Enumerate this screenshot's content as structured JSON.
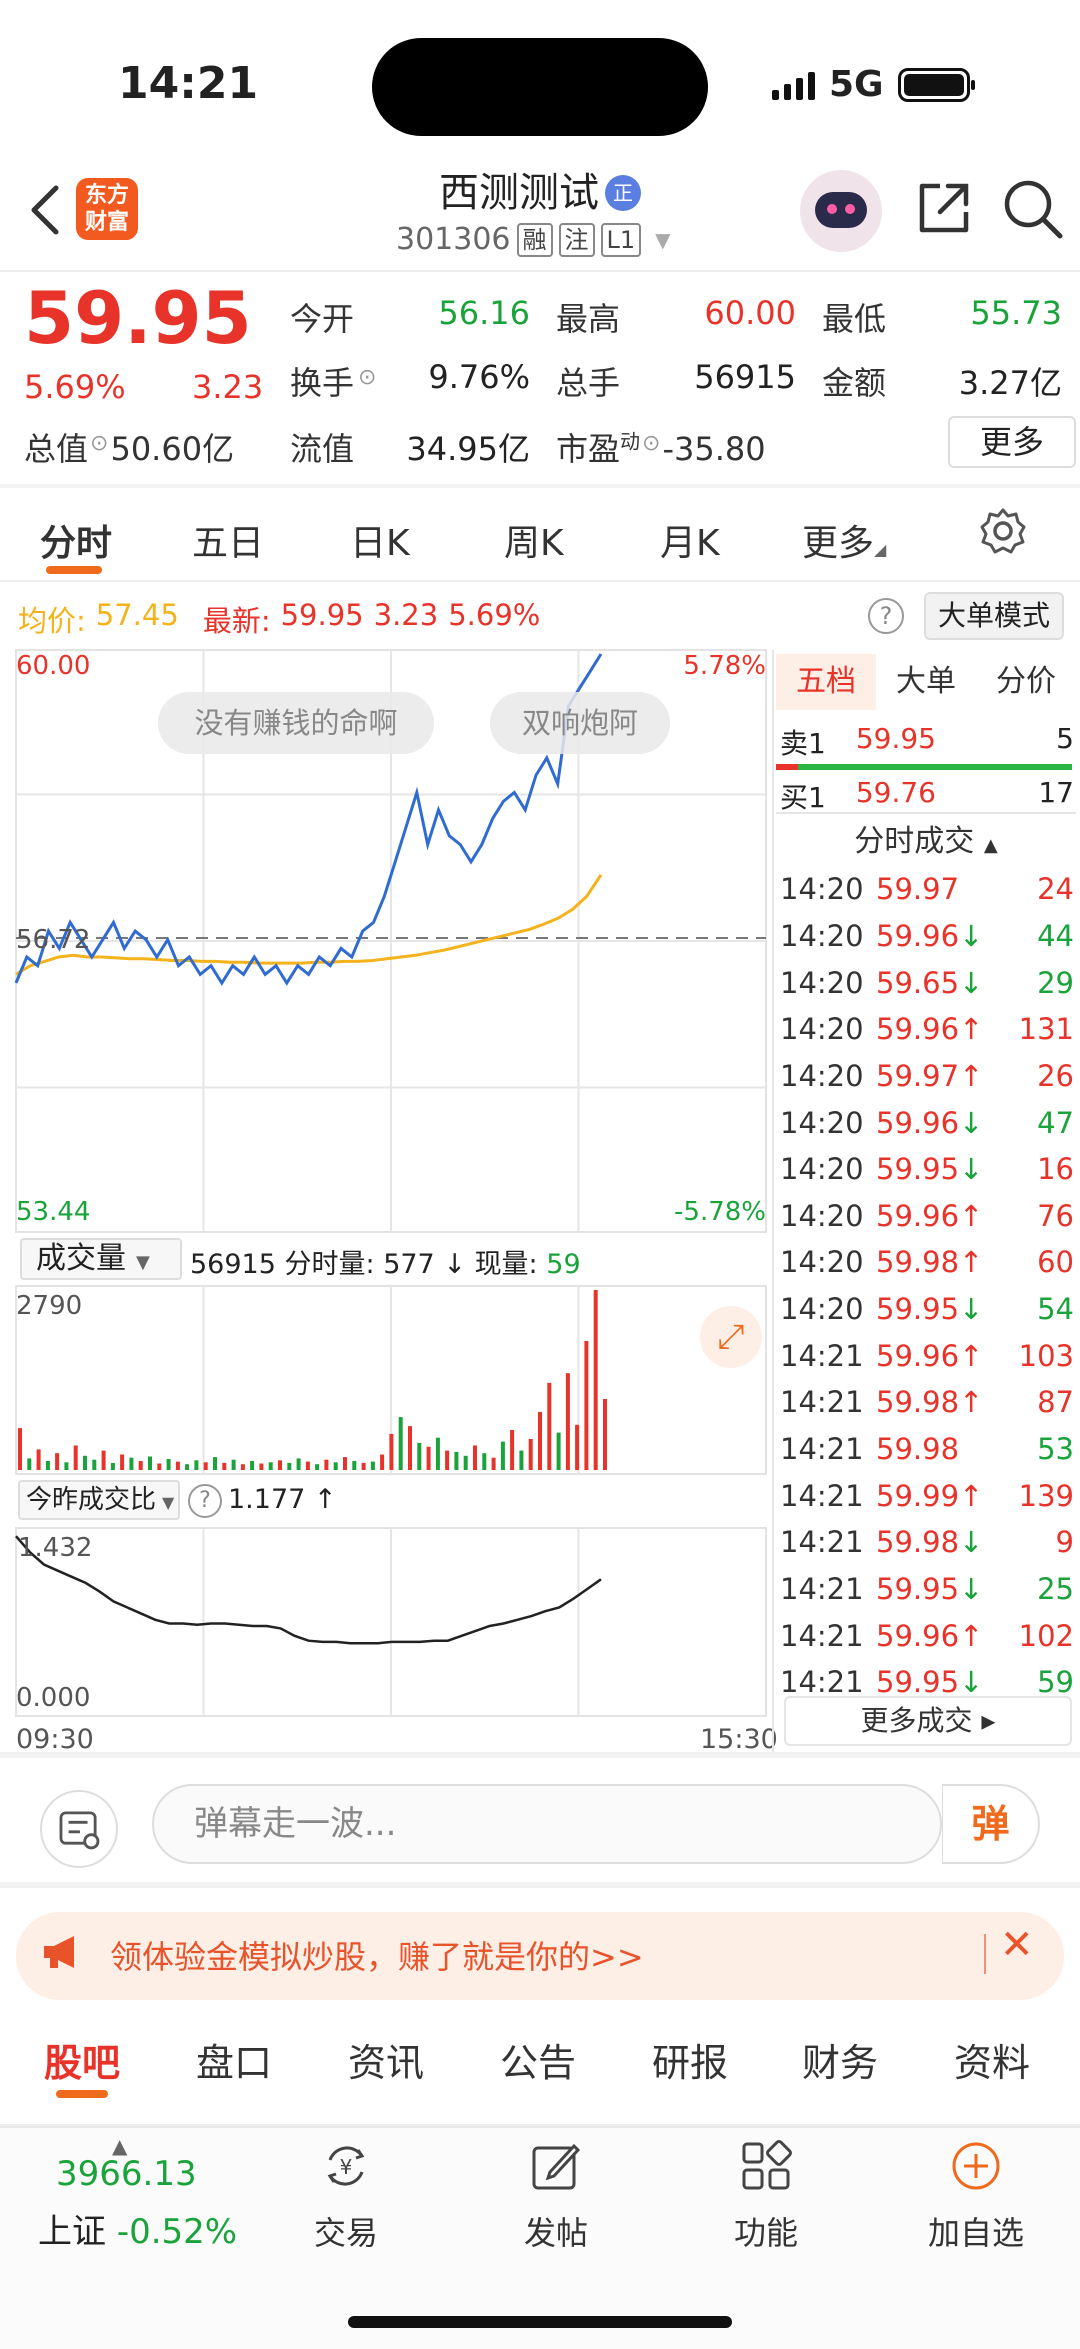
{
  "status": {
    "time": "14:21",
    "network": "5G"
  },
  "header": {
    "logo_line1": "东方",
    "logo_line2": "财富",
    "name": "西测测试",
    "cert_badge": "正",
    "code": "301306",
    "tags": [
      "融",
      "注",
      "L1"
    ]
  },
  "quote": {
    "price": "59.95",
    "change_pct": "5.69%",
    "change_abs": "3.23",
    "rows": [
      [
        {
          "label": "今开",
          "value": "56.16",
          "color": "green"
        },
        {
          "label": "最高",
          "value": "60.00",
          "color": "red"
        },
        {
          "label": "最低",
          "value": "55.73",
          "color": "green"
        }
      ],
      [
        {
          "label": "换手",
          "value": "9.76%",
          "color": "dark"
        },
        {
          "label": "总手",
          "value": "56915",
          "color": "dark"
        },
        {
          "label": "金额",
          "value": "3.27亿",
          "color": "dark"
        }
      ]
    ],
    "row3": {
      "total_label": "总值",
      "total_value": "50.60亿",
      "float_label": "流值",
      "float_value": "34.95亿",
      "pe_label": "市盈",
      "pe_sup": "动",
      "pe_value": "-35.80"
    },
    "more_label": "更多"
  },
  "period_tabs": [
    "分时",
    "五日",
    "日K",
    "周K",
    "月K",
    "更多"
  ],
  "info_line": {
    "avg_label": "均价:",
    "avg_value": "57.45",
    "latest_label": "最新:",
    "latest_value": "59.95",
    "latest_chg": "3.23",
    "latest_pct": "5.69%"
  },
  "big_order_mode": "大单模式",
  "chart_data": [
    {
      "type": "line",
      "x_range": [
        "09:30",
        "15:30"
      ],
      "y_max_label": "60.00",
      "y_min_label": "53.44",
      "ref_label": "56.72",
      "pct_max_label": "5.78%",
      "pct_min_label": "-5.78%",
      "ylim": [
        53.44,
        60.0
      ],
      "reference": 56.72,
      "danmaku": [
        "没有赚钱的命啊",
        "双响炮阿"
      ],
      "series": [
        {
          "values": [
            56.2,
            56.5,
            56.4,
            56.8,
            56.6,
            56.9,
            56.7,
            56.5,
            56.7,
            56.9,
            56.6,
            56.8,
            56.7,
            56.5,
            56.7,
            56.4,
            56.5,
            56.3,
            56.4,
            56.2,
            56.4,
            56.3,
            56.5,
            56.3,
            56.4,
            56.2,
            56.4,
            56.3,
            56.5,
            56.4,
            56.6,
            56.5,
            56.8,
            56.9,
            57.2,
            57.6,
            58.0,
            58.4,
            57.8,
            58.2,
            57.9,
            57.8,
            57.6,
            57.8,
            58.1,
            58.3,
            58.4,
            58.2,
            58.6,
            58.8,
            58.5,
            59.4,
            59.6,
            59.8,
            60.0
          ]
        },
        {
          "values": [
            56.3,
            56.4,
            56.45,
            56.5,
            56.52,
            56.5,
            56.5,
            56.49,
            56.48,
            56.48,
            56.47,
            56.46,
            56.46,
            56.45,
            56.45,
            56.44,
            56.44,
            56.43,
            56.43,
            56.43,
            56.43,
            56.44,
            56.44,
            56.45,
            56.45,
            56.46,
            56.48,
            56.5,
            56.52,
            56.55,
            56.58,
            56.62,
            56.66,
            56.7,
            56.74,
            56.78,
            56.82,
            56.88,
            56.95,
            57.05,
            57.2,
            57.45
          ]
        }
      ]
    },
    {
      "type": "bar",
      "max_label": "2790",
      "ylim": [
        0,
        2790
      ],
      "values": [
        650,
        180,
        320,
        140,
        260,
        120,
        380,
        220,
        160,
        300,
        110,
        240,
        190,
        140,
        210,
        100,
        170,
        130,
        90,
        150,
        120,
        200,
        110,
        160,
        90,
        140,
        100,
        120,
        150,
        110,
        180,
        130,
        90,
        160,
        120,
        200,
        140,
        110,
        130,
        240,
        560,
        820,
        680,
        420,
        360,
        500,
        300,
        280,
        220,
        380,
        260,
        190,
        440,
        620,
        300,
        480,
        900,
        1350,
        580,
        1500,
        700,
        2000,
        2790,
        1100
      ],
      "colors": [
        "r",
        "g",
        "r",
        "g",
        "r",
        "g",
        "r",
        "g",
        "g",
        "r",
        "g",
        "r",
        "g",
        "r",
        "g",
        "r",
        "g",
        "r",
        "g",
        "g",
        "r",
        "g",
        "r",
        "g",
        "r",
        "g",
        "r",
        "g",
        "r",
        "g",
        "g",
        "r",
        "g",
        "r",
        "g",
        "r",
        "g",
        "r",
        "g",
        "r",
        "r",
        "g",
        "r",
        "g",
        "r",
        "g",
        "r",
        "g",
        "g",
        "r",
        "g",
        "r",
        "g",
        "r",
        "g",
        "r",
        "r",
        "r",
        "g",
        "r",
        "r",
        "r",
        "r",
        "r"
      ]
    },
    {
      "type": "line",
      "max_label": "1.432",
      "min_label": "0.000",
      "ylim": [
        0,
        1.432
      ],
      "values": [
        1.43,
        1.3,
        1.2,
        1.15,
        1.1,
        1.05,
        0.98,
        0.9,
        0.85,
        0.8,
        0.75,
        0.72,
        0.72,
        0.71,
        0.72,
        0.72,
        0.71,
        0.7,
        0.7,
        0.68,
        0.62,
        0.58,
        0.57,
        0.57,
        0.56,
        0.56,
        0.56,
        0.57,
        0.57,
        0.57,
        0.58,
        0.58,
        0.62,
        0.66,
        0.7,
        0.72,
        0.75,
        0.78,
        0.82,
        0.85,
        0.92,
        1.0,
        1.08
      ]
    }
  ],
  "volume": {
    "selector": "成交量",
    "total": "56915",
    "minute_label": "分时量:",
    "minute_value": "577",
    "minute_arrow": "↓",
    "now_label": "现量:",
    "now_value": "59"
  },
  "ratio": {
    "selector": "今昨成交比",
    "value": "1.177",
    "arrow": "↑"
  },
  "right_panel": {
    "tabs": [
      "五档",
      "大单",
      "分价"
    ],
    "sell1": {
      "label": "卖1",
      "price": "59.95",
      "vol": "5"
    },
    "buy1": {
      "label": "买1",
      "price": "59.76",
      "vol": "17"
    },
    "ticks_title": "分时成交",
    "ticks": [
      {
        "t": "14:20",
        "p": "59.97",
        "a": "",
        "v": "24",
        "c": "red"
      },
      {
        "t": "14:20",
        "p": "59.96",
        "a": "↓",
        "v": "44",
        "c": "green"
      },
      {
        "t": "14:20",
        "p": "59.65",
        "a": "↓",
        "v": "29",
        "c": "green"
      },
      {
        "t": "14:20",
        "p": "59.96",
        "a": "↑",
        "v": "131",
        "c": "red"
      },
      {
        "t": "14:20",
        "p": "59.97",
        "a": "↑",
        "v": "26",
        "c": "red"
      },
      {
        "t": "14:20",
        "p": "59.96",
        "a": "↓",
        "v": "47",
        "c": "green"
      },
      {
        "t": "14:20",
        "p": "59.95",
        "a": "↓",
        "v": "16",
        "c": "red"
      },
      {
        "t": "14:20",
        "p": "59.96",
        "a": "↑",
        "v": "76",
        "c": "red"
      },
      {
        "t": "14:20",
        "p": "59.98",
        "a": "↑",
        "v": "60",
        "c": "red"
      },
      {
        "t": "14:20",
        "p": "59.95",
        "a": "↓",
        "v": "54",
        "c": "green"
      },
      {
        "t": "14:21",
        "p": "59.96",
        "a": "↑",
        "v": "103",
        "c": "red"
      },
      {
        "t": "14:21",
        "p": "59.98",
        "a": "↑",
        "v": "87",
        "c": "red"
      },
      {
        "t": "14:21",
        "p": "59.98",
        "a": "",
        "v": "53",
        "c": "green"
      },
      {
        "t": "14:21",
        "p": "59.99",
        "a": "↑",
        "v": "139",
        "c": "red"
      },
      {
        "t": "14:21",
        "p": "59.98",
        "a": "↓",
        "v": "9",
        "c": "red"
      },
      {
        "t": "14:21",
        "p": "59.95",
        "a": "↓",
        "v": "25",
        "c": "green"
      },
      {
        "t": "14:21",
        "p": "59.96",
        "a": "↑",
        "v": "102",
        "c": "red"
      },
      {
        "t": "14:21",
        "p": "59.95",
        "a": "↓",
        "v": "59",
        "c": "green"
      }
    ],
    "more_ticks": "更多成交 ▸"
  },
  "danmaku_bar": {
    "placeholder": "弹幕走一波...",
    "send": "弹"
  },
  "promo": {
    "text": "领体验金模拟炒股，赚了就是你的>>",
    "close": "✕"
  },
  "bottom_tabs": [
    "股吧",
    "盘口",
    "资讯",
    "公告",
    "研报",
    "财务",
    "资料"
  ],
  "bottom_nav": {
    "index_value": "3966.13",
    "index_name": "上证",
    "index_change": "-0.52%",
    "items": [
      "交易",
      "发帖",
      "功能",
      "加自选"
    ]
  },
  "colors": {
    "red": "#e8332a",
    "green": "#1aa33a",
    "orange": "#f06a1c",
    "price_line": "#2f6bd1",
    "avg_line": "#f4b21c"
  }
}
